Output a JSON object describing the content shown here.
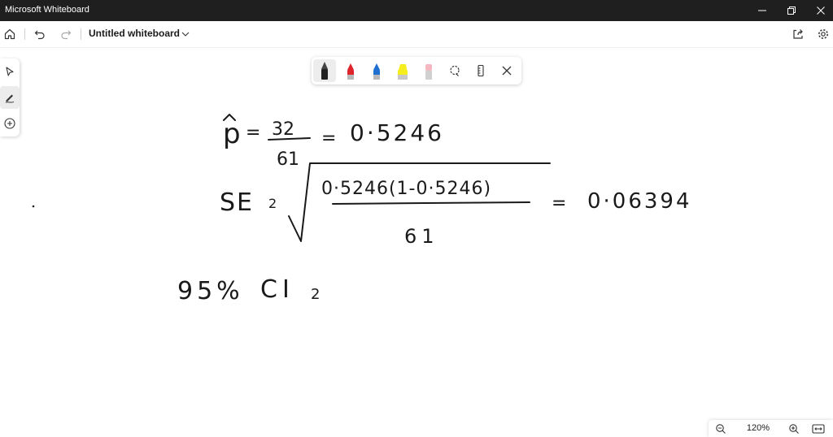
{
  "window": {
    "title": "Microsoft Whiteboard"
  },
  "appbar": {
    "board_title": "Untitled whiteboard"
  },
  "canvas": {
    "phat_symbol": "p",
    "phat_numerator": "32",
    "phat_denominator": "61",
    "phat_equals_1": "=",
    "phat_equals_2": "=",
    "phat_value": "0·5246",
    "se_label": "SE",
    "se_equals": "2",
    "se_numerator": "0·5246(1-0·5246)",
    "se_denominator": "61",
    "se_equals_2": "=",
    "se_value": "0·06394",
    "ci_percent": "95%",
    "ci_label": "CI",
    "ci_equals": "2"
  },
  "zoom": {
    "level": "120%"
  },
  "ink_colors": {
    "black": "#222222",
    "red": "#e0242b",
    "blue": "#1f6fd1",
    "yellow": "#f6ee1c",
    "pink": "#f4b6bf"
  }
}
